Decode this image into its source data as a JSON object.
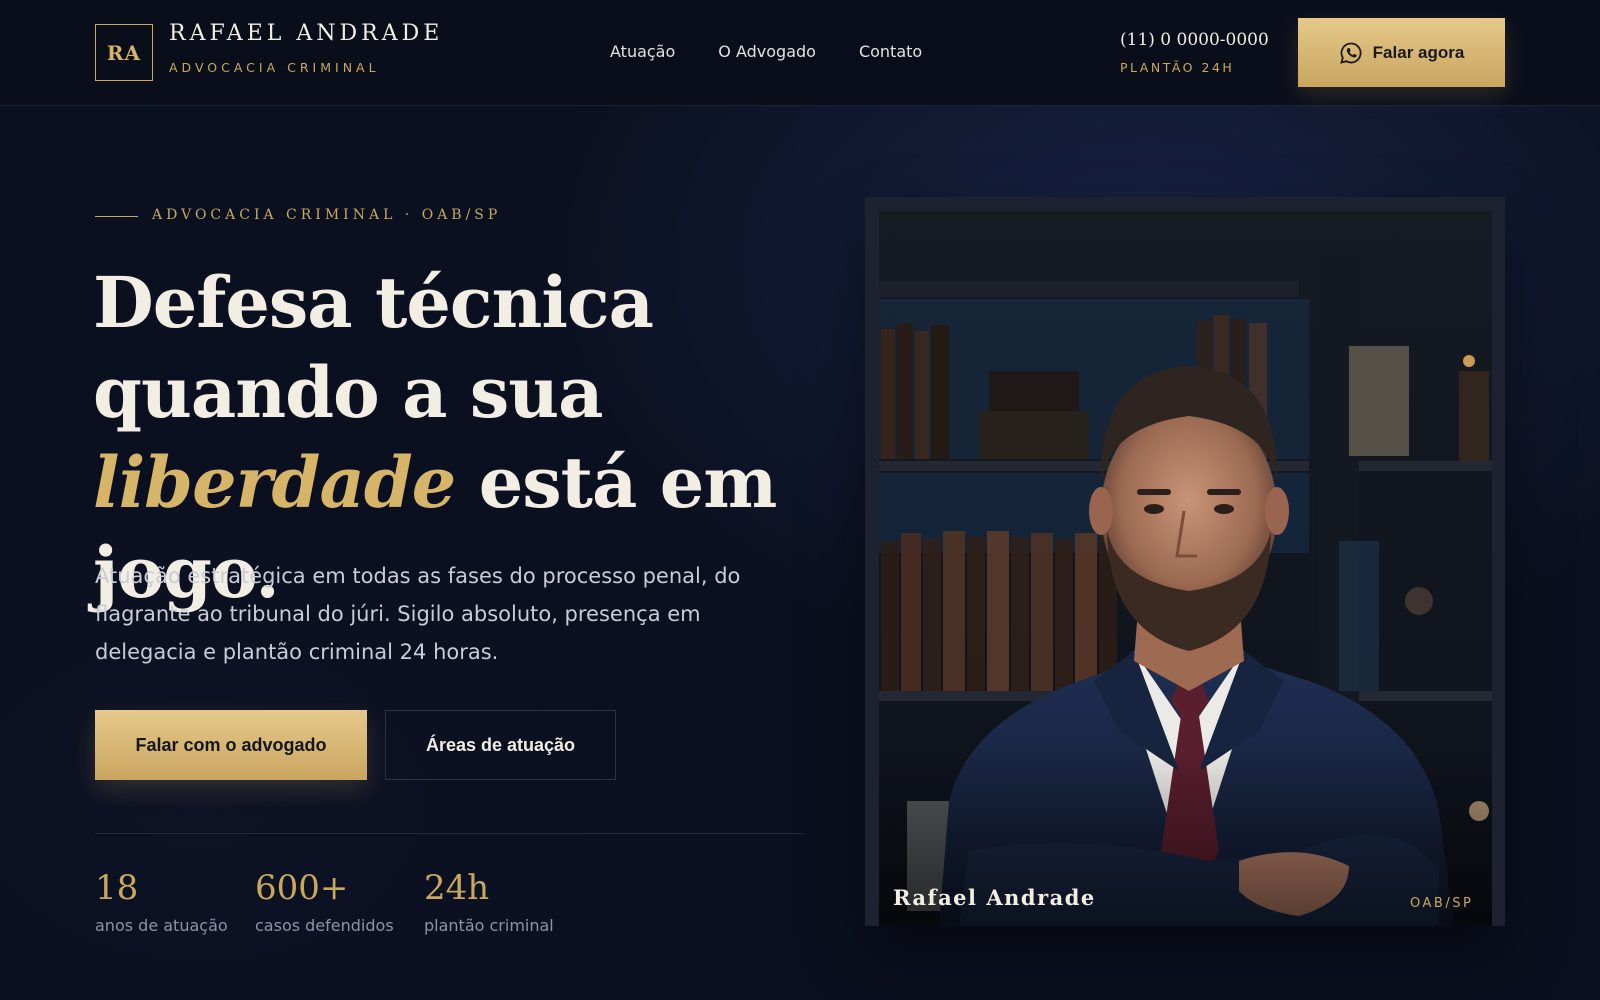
{
  "header": {
    "logo_initials": "RA",
    "brand_name": "RAFAEL ANDRADE",
    "brand_sub": "ADVOCACIA CRIMINAL",
    "nav": [
      {
        "label": "Atuação"
      },
      {
        "label": "O Advogado"
      },
      {
        "label": "Contato"
      }
    ],
    "phone": "(11) 0 0000-0000",
    "phone_sub": "PLANTÃO 24H",
    "cta_label": "Falar agora",
    "cta_icon": "whatsapp-icon"
  },
  "hero": {
    "eyebrow": "ADVOCACIA CRIMINAL · OAB/SP",
    "headline_part1": "Defesa técnica quando a sua ",
    "headline_emphasis": "liberdade",
    "headline_part2": " está em jogo.",
    "lead": "Atuação estratégica em todas as fases do processo penal, do flagrante ao tribunal do júri. Sigilo absoluto, presença em delegacia e plantão criminal 24 horas.",
    "primary_button": "Falar com o advogado",
    "secondary_button": "Áreas de atuação",
    "stats": [
      {
        "value": "18",
        "label": "anos de atuação"
      },
      {
        "value": "600+",
        "label": "casos defendidos"
      },
      {
        "value": "24h",
        "label": "plantão criminal"
      }
    ]
  },
  "portrait": {
    "caption_name": "Rafael Andrade",
    "caption_badge": "OAB/SP"
  },
  "colors": {
    "background": "#0b1020",
    "accent_gold": "#c9a85c",
    "text_light": "#f3eee3"
  }
}
